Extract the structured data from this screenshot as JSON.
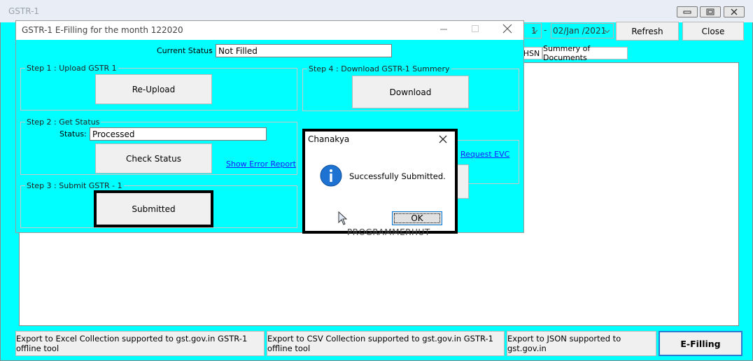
{
  "main_window": {
    "title": "GSTR-1",
    "date_from_partial": "1",
    "date_to": "02/Jan /2021",
    "refresh_label": "Refresh",
    "close_label": "Close",
    "tabs": [
      "HSN",
      "Summery of Documents"
    ],
    "bottom_buttons": {
      "excel": "Export to Excel Collection supported to gst.gov.in GSTR-1 offline tool",
      "csv": "Export to CSV Collection supported to gst.gov.in GSTR-1 offline tool",
      "json": "Export to JSON supported to gst.gov.in",
      "efilling": "E-Filling"
    }
  },
  "efiling_dialog": {
    "title": "GSTR-1 E-Filling for the month 122020",
    "current_status_label": "Current Status",
    "colon": ":",
    "current_status_value": "Not Filled",
    "step1": {
      "title": "Step 1 : Upload GSTR 1",
      "button": "Re-Upload"
    },
    "step2": {
      "title": "Step 2 : Get Status",
      "status_label": "Status",
      "status_value": "Processed",
      "button": "Check Status",
      "error_link": "Show Error Report"
    },
    "step3": {
      "title": "Step 3 : Submit GSTR - 1",
      "button": "Submitted"
    },
    "step4": {
      "title": "Step 4 : Download GSTR-1 Summery",
      "button": "Download"
    },
    "request_evc_link": "Request EVC"
  },
  "message_box": {
    "title": "Chanakya",
    "message": "Successfully Submitted.",
    "ok_label": "OK",
    "icon": "info-icon"
  },
  "watermark": "PROGRAMMERHUT",
  "colors": {
    "background": "#00ffff",
    "link": "#1a1aff",
    "info_icon": "#1e73d2"
  }
}
